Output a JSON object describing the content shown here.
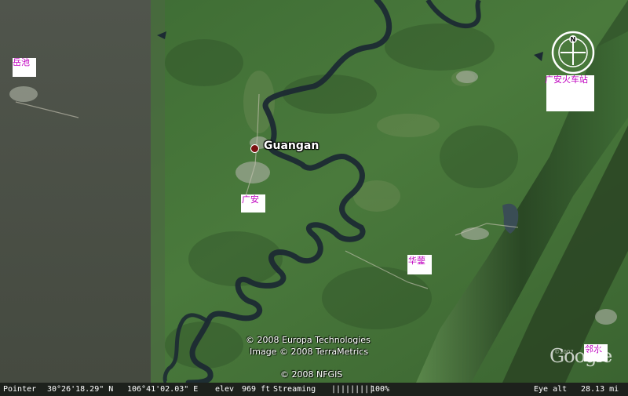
{
  "map": {
    "place_name": "Guangan",
    "labels": {
      "yuechi": "岳池",
      "guangan_station": "广安火车站",
      "guangan": "广安",
      "huaying": "华蓥",
      "linshui": "邻水"
    },
    "compass_letter": "N",
    "credits": {
      "line1": "© 2008 Europa Technologies",
      "line2": "Image © 2008 TerraMetrics",
      "line3": "© 2008 NFGIS"
    },
    "logo_text": "Google",
    "logo_year": "©2007"
  },
  "statusbar": {
    "pointer_label": "Pointer",
    "latitude": "30°26'18.29\" N",
    "longitude": "106°41'02.03\" E",
    "elev_label": "elev",
    "elev_value": "969 ft",
    "streaming_label": "Streaming",
    "streaming_bar": "|||||||||",
    "streaming_pct": "100%",
    "eye_alt_label": "Eye alt",
    "eye_alt_value": "28.13 mi"
  },
  "colors": {
    "label_text": "#c000c0",
    "river": "#1c2a33",
    "vegetation": "#3f6a34",
    "left_tile": "#4a4f45",
    "ridge": "#2c4a26"
  }
}
